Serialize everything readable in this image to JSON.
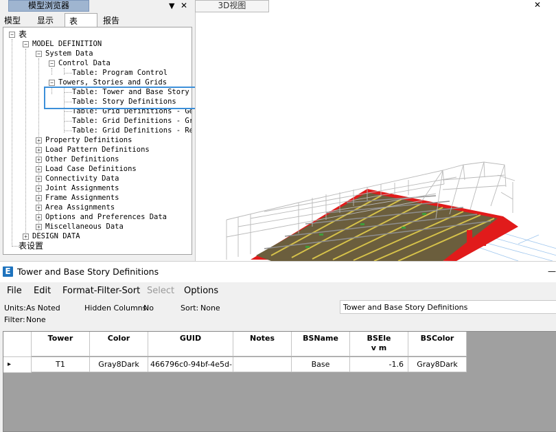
{
  "browser": {
    "title": "模型浏览器",
    "pin": "▼",
    "close": "✕",
    "tabs": [
      "模型",
      "显示",
      "表",
      "报告"
    ],
    "tree": [
      {
        "label": "表",
        "toggle": "−"
      },
      {
        "label": "MODEL DEFINITION",
        "toggle": "−"
      },
      {
        "label": "System Data",
        "toggle": "−"
      },
      {
        "label": "Control Data",
        "toggle": "−"
      },
      {
        "label": "Table:  Program Control",
        "toggle": ""
      },
      {
        "label": "Towers, Stories and Grids",
        "toggle": "−"
      },
      {
        "label": "Table:  Tower and Base Story",
        "toggle": ""
      },
      {
        "label": "Table:  Story Definitions",
        "toggle": ""
      },
      {
        "label": "Table:  Grid Definitions - Ge",
        "toggle": ""
      },
      {
        "label": "Table:  Grid Definitions - Gr",
        "toggle": ""
      },
      {
        "label": "Table:  Grid Definitions - Re",
        "toggle": ""
      },
      {
        "label": "Property Definitions",
        "toggle": "+"
      },
      {
        "label": "Load Pattern Definitions",
        "toggle": "+"
      },
      {
        "label": "Other Definitions",
        "toggle": "+"
      },
      {
        "label": "Load Case Definitions",
        "toggle": "+"
      },
      {
        "label": "Connectivity Data",
        "toggle": "+"
      },
      {
        "label": "Joint Assignments",
        "toggle": "+"
      },
      {
        "label": "Frame Assignments",
        "toggle": "+"
      },
      {
        "label": "Area Assignments",
        "toggle": "+"
      },
      {
        "label": "Options and Preferences Data",
        "toggle": "+"
      },
      {
        "label": "Miscellaneous Data",
        "toggle": "+"
      },
      {
        "label": "DESIGN DATA",
        "toggle": "+"
      },
      {
        "label": "表设置",
        "toggle": ""
      }
    ]
  },
  "view3d": {
    "tab": "3D视图",
    "close": "✕",
    "colors": {
      "slab_red": "#e11b1b",
      "frame_grey": "#9a9a9a",
      "beam_yellow": "#d6c24a"
    }
  },
  "table_window": {
    "title": "Tower and Base Story Definitions",
    "icon_letter": "E",
    "minimize": "—",
    "menu": [
      {
        "label": "File",
        "enabled": true
      },
      {
        "label": "Edit",
        "enabled": true
      },
      {
        "label": "Format-Filter-Sort",
        "enabled": true
      },
      {
        "label": "Select",
        "enabled": false
      },
      {
        "label": "Options",
        "enabled": true
      }
    ],
    "units_label": "Units:",
    "units_value": "As Noted",
    "hidden_label": "Hidden Columns:",
    "hidden_value": "No",
    "sort_label": "Sort:",
    "sort_value": "None",
    "filter_label": "Filter:",
    "filter_value": "None",
    "title_field": "Tower and Base Story Definitions",
    "columns": [
      "Tower",
      "Color",
      "GUID",
      "Notes",
      "BSName",
      "BSElev m",
      "BSColor"
    ],
    "rows": [
      {
        "marker": "▸",
        "cells": [
          "T1",
          "Gray8Dark",
          "466796c0-94bf-4e5d-...",
          "",
          "Base",
          "-1.6",
          "Gray8Dark"
        ]
      }
    ]
  }
}
